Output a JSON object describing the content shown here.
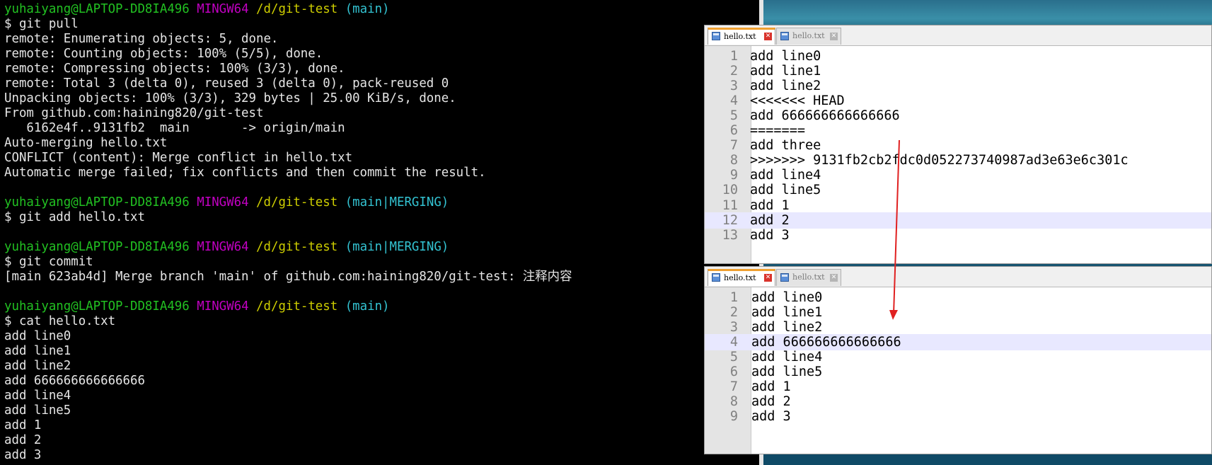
{
  "terminal": {
    "lines": [
      {
        "user": "yuhaiyang@LAPTOP-DD8IA496",
        "system": "MINGW64",
        "path": "/d/git-test",
        "branch": "(main)"
      },
      {
        "text": "$ git pull"
      },
      {
        "text": "remote: Enumerating objects: 5, done."
      },
      {
        "text": "remote: Counting objects: 100% (5/5), done."
      },
      {
        "text": "remote: Compressing objects: 100% (3/3), done."
      },
      {
        "text": "remote: Total 3 (delta 0), reused 3 (delta 0), pack-reused 0"
      },
      {
        "text": "Unpacking objects: 100% (3/3), 329 bytes | 25.00 KiB/s, done."
      },
      {
        "text": "From github.com:haining820/git-test"
      },
      {
        "text": "   6162e4f..9131fb2  main       -> origin/main"
      },
      {
        "text": "Auto-merging hello.txt"
      },
      {
        "text": "CONFLICT (content): Merge conflict in hello.txt"
      },
      {
        "text": "Automatic merge failed; fix conflicts and then commit the result."
      },
      {
        "text": ""
      },
      {
        "user": "yuhaiyang@LAPTOP-DD8IA496",
        "system": "MINGW64",
        "path": "/d/git-test",
        "branch": "(main|MERGING)"
      },
      {
        "text": "$ git add hello.txt"
      },
      {
        "text": ""
      },
      {
        "user": "yuhaiyang@LAPTOP-DD8IA496",
        "system": "MINGW64",
        "path": "/d/git-test",
        "branch": "(main|MERGING)"
      },
      {
        "text": "$ git commit"
      },
      {
        "text": "[main 623ab4d] Merge branch 'main' of github.com:haining820/git-test: 注释内容"
      },
      {
        "text": ""
      },
      {
        "user": "yuhaiyang@LAPTOP-DD8IA496",
        "system": "MINGW64",
        "path": "/d/git-test",
        "branch": "(main)"
      },
      {
        "text": "$ cat hello.txt"
      },
      {
        "text": "add line0"
      },
      {
        "text": "add line1"
      },
      {
        "text": "add line2"
      },
      {
        "text": "add 666666666666666"
      },
      {
        "text": "add line4"
      },
      {
        "text": "add line5"
      },
      {
        "text": "add 1"
      },
      {
        "text": "add 2"
      },
      {
        "text": "add 3"
      }
    ]
  },
  "editor_top": {
    "tabs": [
      {
        "label": "hello.txt",
        "close": "✕",
        "active": true
      },
      {
        "label": "hello.txt",
        "close": "✕",
        "active": false
      }
    ],
    "lines": [
      {
        "n": "1",
        "text": "add line0"
      },
      {
        "n": "2",
        "text": "add line1"
      },
      {
        "n": "3",
        "text": "add line2"
      },
      {
        "n": "4",
        "text": "<<<<<<< HEAD"
      },
      {
        "n": "5",
        "text": "add 666666666666666"
      },
      {
        "n": "6",
        "text": "======="
      },
      {
        "n": "7",
        "text": "add three"
      },
      {
        "n": "8",
        "text": ">>>>>>> 9131fb2cb2fdc0d052273740987ad3e63e6c301c"
      },
      {
        "n": "9",
        "text": "add line4"
      },
      {
        "n": "10",
        "text": "add line5"
      },
      {
        "n": "11",
        "text": "add 1"
      },
      {
        "n": "12",
        "text": "add 2",
        "highlight": true
      },
      {
        "n": "13",
        "text": "add 3"
      }
    ]
  },
  "editor_bottom": {
    "tabs": [
      {
        "label": "hello.txt",
        "close": "✕",
        "active": true
      },
      {
        "label": "hello.txt",
        "close": "✕",
        "active": false
      }
    ],
    "lines": [
      {
        "n": "1",
        "text": "add line0"
      },
      {
        "n": "2",
        "text": "add line1"
      },
      {
        "n": "3",
        "text": "add line2"
      },
      {
        "n": "4",
        "text": "add 666666666666666",
        "highlight": true
      },
      {
        "n": "5",
        "text": "add line4"
      },
      {
        "n": "6",
        "text": "add line5"
      },
      {
        "n": "7",
        "text": "add 1"
      },
      {
        "n": "8",
        "text": "add 2"
      },
      {
        "n": "9",
        "text": "add 3"
      }
    ]
  },
  "colors": {
    "terminal_bg": "#000000",
    "prompt_user": "#22c122",
    "prompt_system": "#c100c1",
    "prompt_path": "#cdcd00",
    "prompt_branch": "#33c3d2",
    "arrow": "#e02020",
    "line_highlight": "#e8e8ff",
    "active_tab_accent": "#f0a030"
  }
}
